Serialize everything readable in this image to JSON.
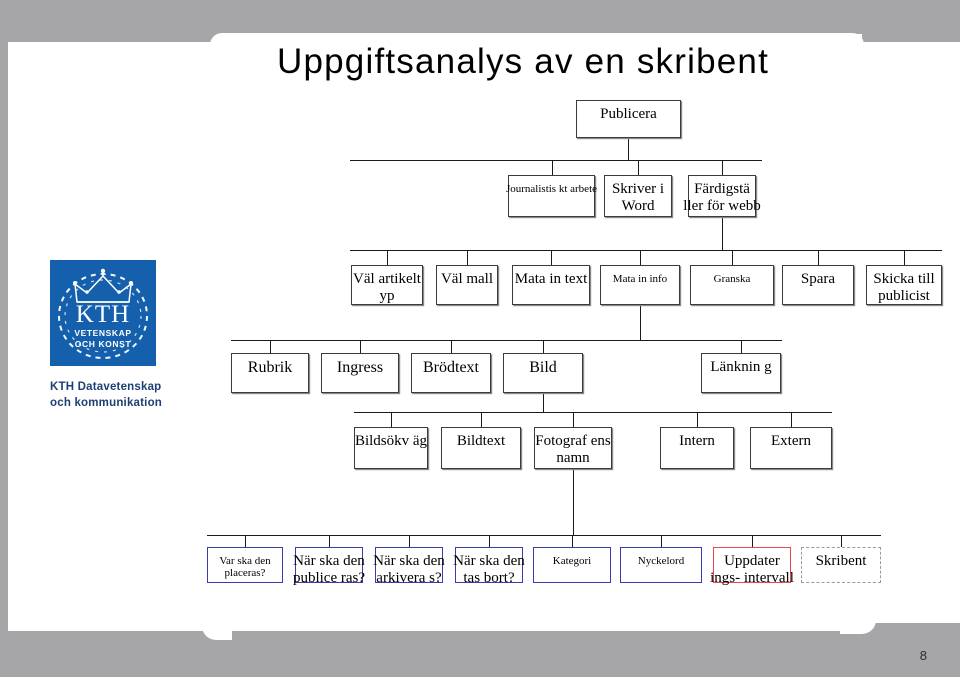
{
  "slide": {
    "title": "Uppgiftsanalys av en skribent",
    "page_number": "8",
    "accent_blue": "#1560ac",
    "node_blue": "#3b3bb0",
    "node_red": "#e8494a",
    "frame_gray": "#a6a6a8"
  },
  "logo": {
    "mark_text": "KTH",
    "motto_line1": "VETENSKAP",
    "motto_line2": "OCH KONST",
    "caption_line1": "KTH Datavetenskap",
    "caption_line2": "och kommunikation"
  },
  "diagram": {
    "type": "hierarchy",
    "root": {
      "label": "Publicera"
    },
    "levels": [
      {
        "name": "level-1",
        "nodes": [
          {
            "id": "journalistiskt",
            "label": "Journalistis kt arbete",
            "style": "plain",
            "size": "sm"
          },
          {
            "id": "skriver-word",
            "label": "Skriver i Word",
            "style": "plain",
            "size": "md"
          },
          {
            "id": "fardigstaller",
            "label": "Färdigstä ller för webb",
            "style": "plain",
            "size": "md"
          }
        ]
      },
      {
        "name": "level-2",
        "nodes": [
          {
            "id": "valj-artikeltyp",
            "label": "Väl artikelt yp",
            "style": "plain",
            "size": "md"
          },
          {
            "id": "valj-mall",
            "label": "Väl mall",
            "style": "plain",
            "size": "md"
          },
          {
            "id": "mata-in-text",
            "label": "Mata in text",
            "style": "plain",
            "size": "md"
          },
          {
            "id": "mata-in-info",
            "label": "Mata in info",
            "style": "plain",
            "size": "sm"
          },
          {
            "id": "granska",
            "label": "Granska",
            "style": "plain",
            "size": "sm"
          },
          {
            "id": "spara",
            "label": "Spara",
            "style": "plain",
            "size": "md"
          },
          {
            "id": "skicka-publicist",
            "label": "Skicka till publicist",
            "style": "plain",
            "size": "md"
          }
        ]
      },
      {
        "name": "level-3",
        "nodes": [
          {
            "id": "rubrik",
            "label": "Rubrik",
            "style": "plain",
            "size": "lg"
          },
          {
            "id": "ingress",
            "label": "Ingress",
            "style": "plain",
            "size": "lg"
          },
          {
            "id": "brodtext",
            "label": "Brödtext",
            "style": "plain",
            "size": "lg"
          },
          {
            "id": "bild",
            "label": "Bild",
            "style": "plain",
            "size": "lg"
          },
          {
            "id": "lankning",
            "label": "Länknin g",
            "style": "plain",
            "size": "md"
          }
        ]
      },
      {
        "name": "level-4",
        "nodes": [
          {
            "id": "bildsokvag",
            "label": "Bildsökv äg",
            "style": "plain",
            "size": "md"
          },
          {
            "id": "bildtext",
            "label": "Bildtext",
            "style": "plain",
            "size": "md"
          },
          {
            "id": "fotografens-namn",
            "label": "Fotograf ens namn",
            "style": "plain",
            "size": "md"
          },
          {
            "id": "intern",
            "label": "Intern",
            "style": "plain",
            "size": "md"
          },
          {
            "id": "extern",
            "label": "Extern",
            "style": "plain",
            "size": "md"
          }
        ]
      },
      {
        "name": "level-5",
        "nodes": [
          {
            "id": "var-placeras",
            "label": "Var ska den placeras?",
            "style": "blue",
            "size": "sm"
          },
          {
            "id": "nar-publiceras",
            "label": "När ska den publice ras?",
            "style": "blue",
            "size": "md"
          },
          {
            "id": "nar-arkiveras",
            "label": "När ska den arkivera s?",
            "style": "blue",
            "size": "md"
          },
          {
            "id": "nar-tas-bort",
            "label": "När ska den tas bort?",
            "style": "blue",
            "size": "md"
          },
          {
            "id": "kategori",
            "label": "Kategori",
            "style": "blue",
            "size": "sm"
          },
          {
            "id": "nyckelord",
            "label": "Nyckelord",
            "style": "blue",
            "size": "sm"
          },
          {
            "id": "uppdateringsintervall",
            "label": "Uppdater ings- intervall",
            "style": "red",
            "size": "md"
          },
          {
            "id": "skribent",
            "label": "Skribent",
            "style": "dashed",
            "size": "md"
          }
        ]
      }
    ]
  }
}
